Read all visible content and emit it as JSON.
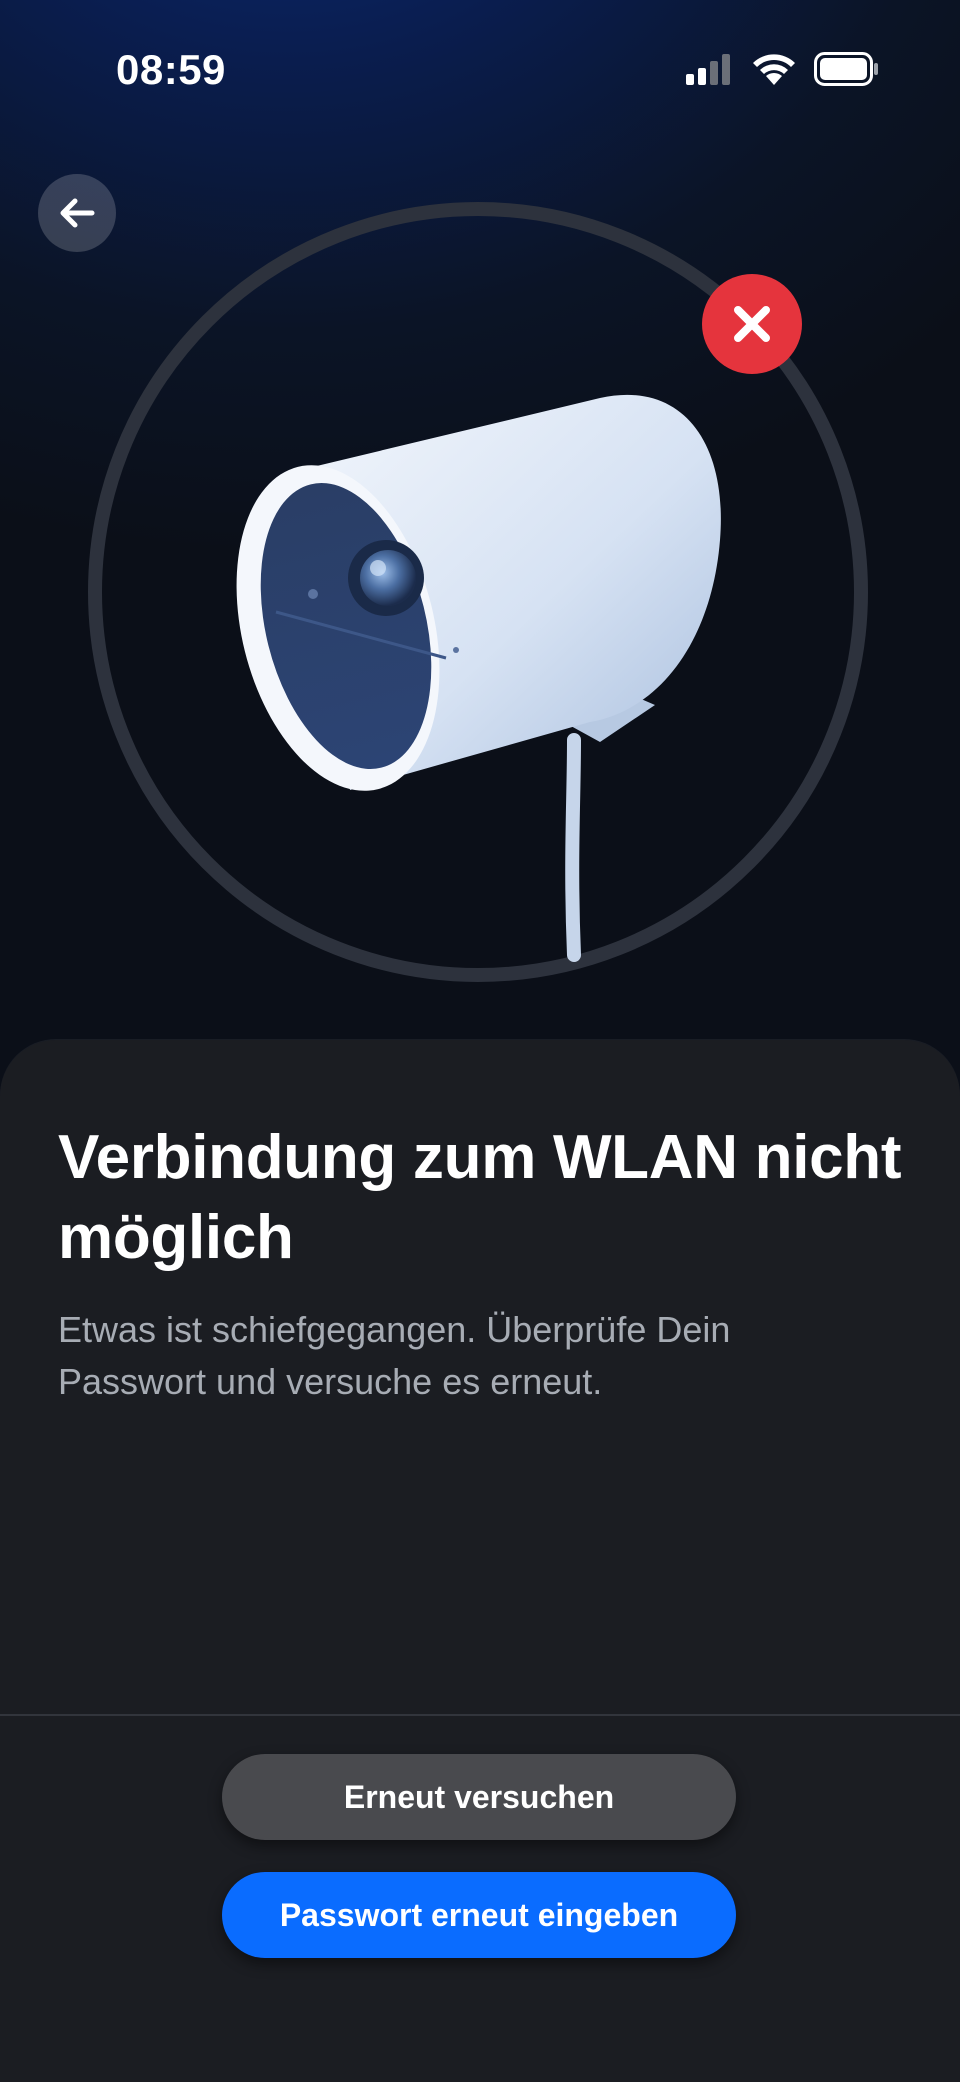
{
  "status_bar": {
    "time": "08:59",
    "icons": [
      "cellular-signal-icon",
      "wifi-icon",
      "battery-icon"
    ]
  },
  "header": {
    "back_icon": "arrow-left-icon"
  },
  "illustration": {
    "subject": "security-camera-icon",
    "status_badge_icon": "close-icon",
    "status_color": "#e5343d"
  },
  "content": {
    "title": "Verbindung zum WLAN nicht möglich",
    "message": "Etwas ist schiefgegangen. Überprüfe Dein Passwort und versuche es erneut."
  },
  "actions": {
    "retry_label": "Erneut versuchen",
    "reenter_password_label": "Passwort erneut eingeben"
  },
  "colors": {
    "primary": "#0a6cff",
    "secondary": "#494a4e",
    "error": "#e5343d",
    "sheet": "#1b1d22"
  }
}
